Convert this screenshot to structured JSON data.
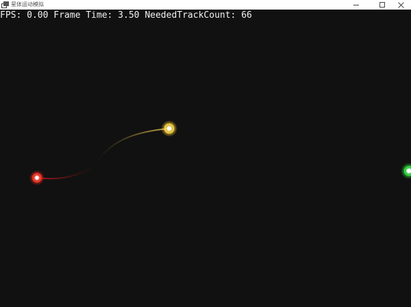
{
  "window": {
    "title": "星体运动模拟",
    "controls": {
      "minimize_icon": "minimize-icon",
      "maximize_icon": "maximize-icon",
      "close_icon": "close-icon"
    }
  },
  "stats": {
    "text": "FPS: 0.00 Frame Time: 3.50 NeededTrackCount: 66",
    "fps": "0.00",
    "frame_time": "3.50",
    "needed_track_count": "66"
  },
  "bodies": [
    {
      "name": "red-body",
      "color": "#ff4a3a"
    },
    {
      "name": "yellow-body",
      "color": "#ffe066"
    },
    {
      "name": "green-body",
      "color": "#4cff5a"
    }
  ],
  "colors": {
    "background": "#111111",
    "text": "#f2f2f2",
    "red_trail": "#b01818",
    "yellow_trail": "#c8b040"
  }
}
